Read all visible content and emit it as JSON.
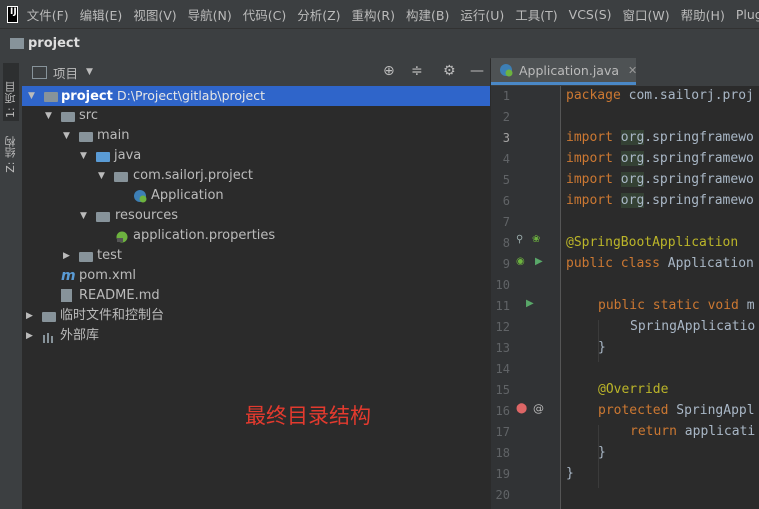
{
  "menubar": {
    "logo": "IJ",
    "items": [
      "文件(F)",
      "编辑(E)",
      "视图(V)",
      "导航(N)",
      "代码(C)",
      "分析(Z)",
      "重构(R)",
      "构建(B)",
      "运行(U)",
      "工具(T)",
      "VCS(S)",
      "窗口(W)",
      "帮助(H)",
      "Plugin"
    ]
  },
  "navbar": {
    "title": "project"
  },
  "left_strip": {
    "project_tab": "1: 项目",
    "structure_tab": "Z: 结构"
  },
  "project_panel": {
    "header_label": "项目",
    "tree": [
      {
        "label": "project",
        "path": "D:\\Project\\gitlab\\project"
      },
      {
        "label": "src"
      },
      {
        "label": "main"
      },
      {
        "label": "java"
      },
      {
        "label": "com.sailorj.project"
      },
      {
        "label": "Application"
      },
      {
        "label": "resources"
      },
      {
        "label": "application.properties"
      },
      {
        "label": "test"
      },
      {
        "label": "pom.xml"
      },
      {
        "label": "README.md"
      },
      {
        "label": "临时文件和控制台"
      },
      {
        "label": "外部库"
      }
    ],
    "annotation": "最终目录结构"
  },
  "editor": {
    "tab_label": "Application.java",
    "line_numbers": [
      "1",
      "2",
      "3",
      "4",
      "5",
      "6",
      "7",
      "8",
      "9",
      "10",
      "11",
      "12",
      "13",
      "14",
      "15",
      "16",
      "17",
      "18",
      "19",
      "20"
    ],
    "lines": {
      "l1_kw": "package",
      "l1_rest": " com.sailorj.proj",
      "imp_kw": "import",
      "imp_pkg": "org",
      "imp_rest": ".springframewo",
      "l8": "@SpringBootApplication",
      "l9_kw": "public class",
      "l9_rest": " Application",
      "l11_kw": "public static void",
      "l11_rest": " m",
      "l12": "SpringApplicatio",
      "l13": "}",
      "l15": "@Override",
      "l16_kw": "protected",
      "l16_rest": " SpringAppl",
      "l17_kw": "return",
      "l17_rest": " applicati",
      "l18": "}",
      "l19": "}"
    }
  }
}
